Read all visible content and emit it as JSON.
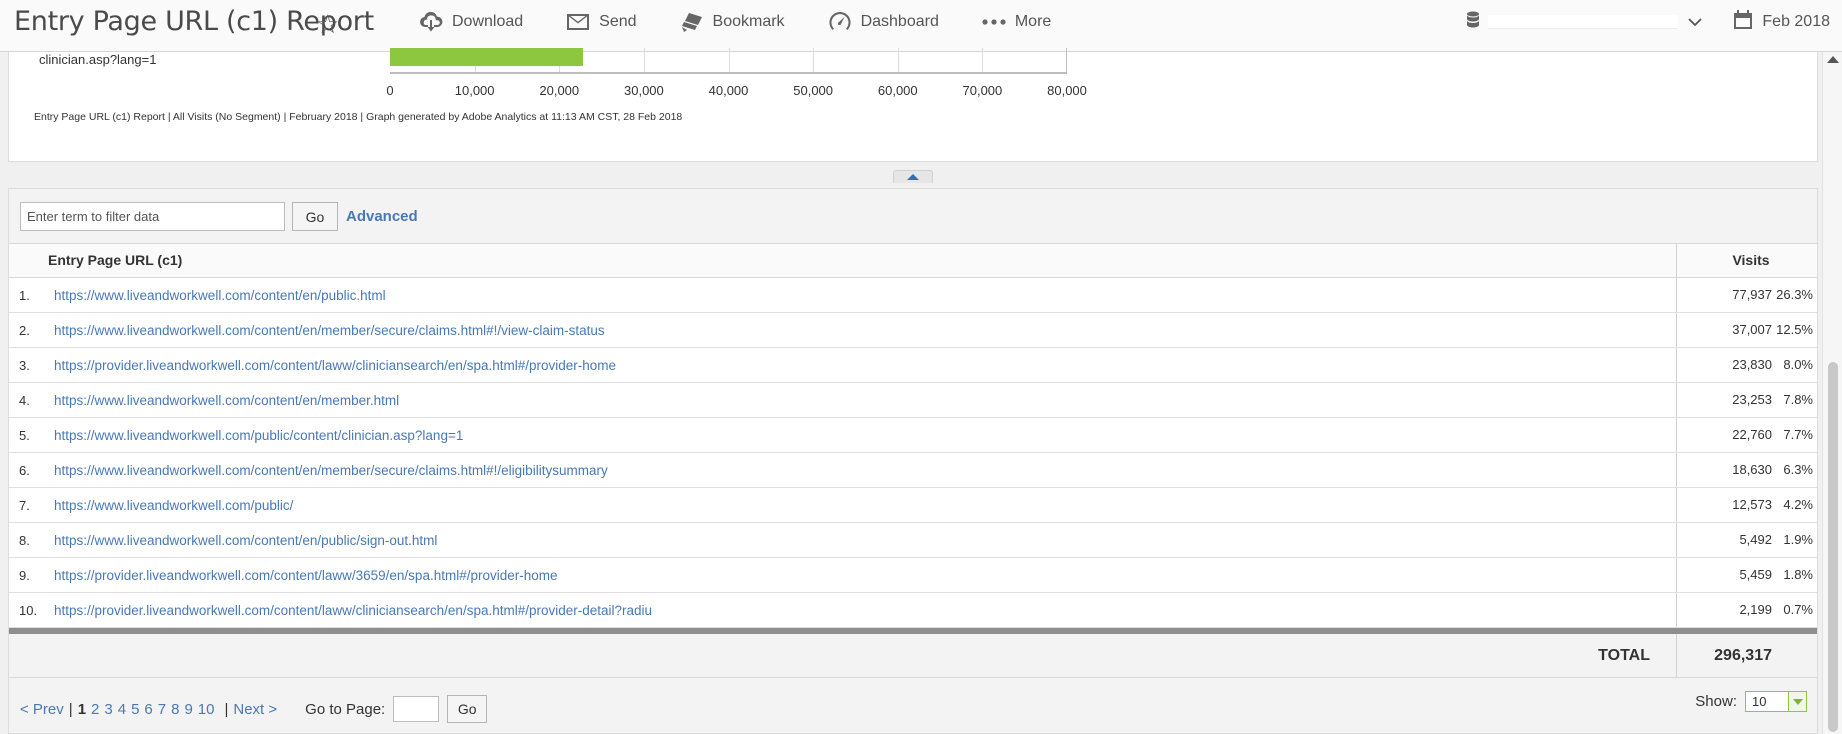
{
  "header": {
    "title": "Entry Page URL (c1) Report",
    "tools": [
      {
        "label": "Download",
        "icon": "cloud-download-icon"
      },
      {
        "label": "Send",
        "icon": "envelope-icon"
      },
      {
        "label": "Bookmark",
        "icon": "bookmark-icon"
      },
      {
        "label": "Dashboard",
        "icon": "dashboard-gauge-icon"
      },
      {
        "label": "More",
        "icon": "more-dots-icon"
      }
    ],
    "date_label": "Feb 2018"
  },
  "graph": {
    "bar_label": "clinician.asp?lang=1",
    "footer": "Entry Page URL (c1) Report | All Visits (No Segment) | February 2018 | Graph generated by Adobe Analytics at 11:13 AM CST, 28 Feb 2018"
  },
  "chart_data": {
    "type": "bar",
    "orientation": "horizontal",
    "categories": [
      "clinician.asp?lang=1"
    ],
    "values": [
      22760
    ],
    "xlim": [
      0,
      80000
    ],
    "ticks": [
      "0",
      "10,000",
      "20,000",
      "30,000",
      "40,000",
      "50,000",
      "60,000",
      "70,000",
      "80,000"
    ],
    "grid": true,
    "bar_color": "#8dc63f"
  },
  "filter": {
    "placeholder": "Enter term to filter data",
    "go_label": "Go",
    "advanced_label": "Advanced"
  },
  "table": {
    "columns": {
      "name": "Entry Page URL (c1)",
      "visits": "Visits"
    },
    "rows": [
      {
        "rank": "1.",
        "url": "https://www.liveandworkwell.com/content/en/public.html",
        "visits": "77,937",
        "pct": "26.3%"
      },
      {
        "rank": "2.",
        "url": "https://www.liveandworkwell.com/content/en/member/secure/claims.html#!/view-claim-status",
        "visits": "37,007",
        "pct": "12.5%"
      },
      {
        "rank": "3.",
        "url": "https://provider.liveandworkwell.com/content/laww/cliniciansearch/en/spa.html#/provider-home",
        "visits": "23,830",
        "pct": "8.0%"
      },
      {
        "rank": "4.",
        "url": "https://www.liveandworkwell.com/content/en/member.html",
        "visits": "23,253",
        "pct": "7.8%"
      },
      {
        "rank": "5.",
        "url": "https://www.liveandworkwell.com/public/content/clinician.asp?lang=1",
        "visits": "22,760",
        "pct": "7.7%"
      },
      {
        "rank": "6.",
        "url": "https://www.liveandworkwell.com/content/en/member/secure/claims.html#!/eligibilitysummary",
        "visits": "18,630",
        "pct": "6.3%"
      },
      {
        "rank": "7.",
        "url": "https://www.liveandworkwell.com/public/",
        "visits": "12,573",
        "pct": "4.2%"
      },
      {
        "rank": "8.",
        "url": "https://www.liveandworkwell.com/content/en/public/sign-out.html",
        "visits": "5,492",
        "pct": "1.9%"
      },
      {
        "rank": "9.",
        "url": "https://provider.liveandworkwell.com/content/laww/3659/en/spa.html#/provider-home",
        "visits": "5,459",
        "pct": "1.8%"
      },
      {
        "rank": "10.",
        "url": "https://provider.liveandworkwell.com/content/laww/cliniciansearch/en/spa.html#/provider-detail?radiu",
        "visits": "2,199",
        "pct": "0.7%"
      }
    ],
    "total_label": "TOTAL",
    "total_value": "296,317"
  },
  "pager": {
    "prev_label": "< Prev",
    "next_label": "Next >",
    "pages": [
      "1",
      "2",
      "3",
      "4",
      "5",
      "6",
      "7",
      "8",
      "9",
      "10"
    ],
    "current": "1",
    "goto_label": "Go to Page:",
    "go_label": "Go",
    "show_label": "Show:",
    "show_value": "10"
  }
}
